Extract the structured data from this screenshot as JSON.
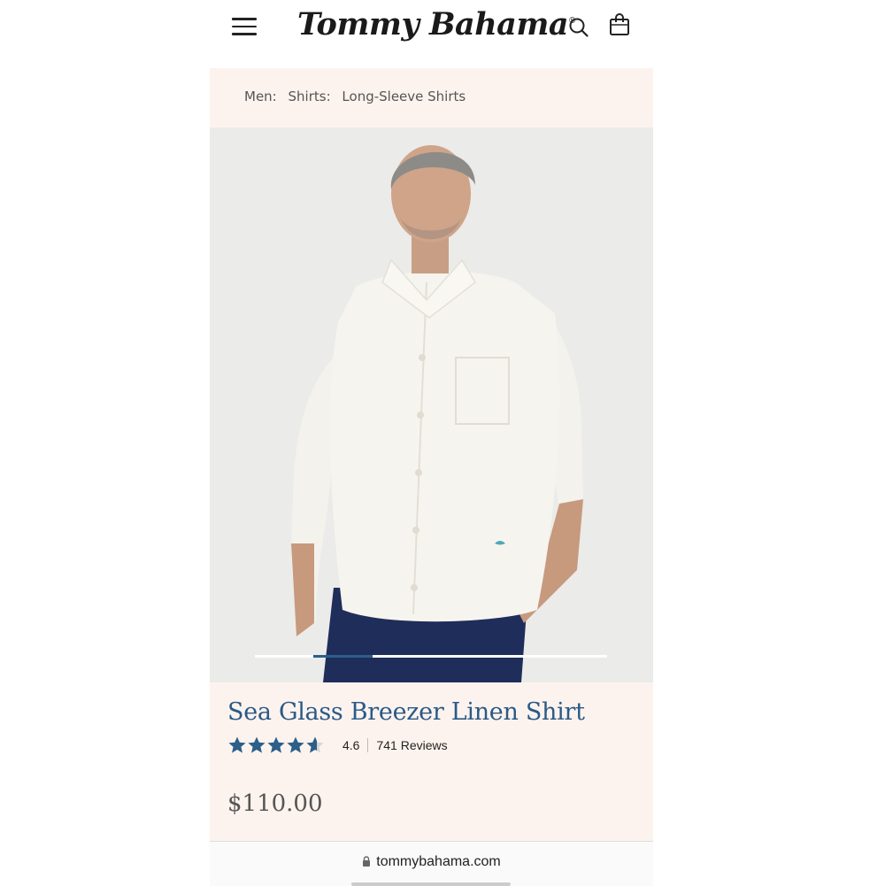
{
  "header": {
    "logo_text": "Tommy Bahama",
    "logo_mark": "®",
    "icons": [
      "menu-icon",
      "search-icon",
      "shopping-bag-icon"
    ]
  },
  "breadcrumb": [
    {
      "label": "Men:"
    },
    {
      "label": "Shirts:"
    },
    {
      "label": "Long-Sleeve Shirts"
    }
  ],
  "product": {
    "title": "Sea Glass Breezer Linen Shirt",
    "rating": "4.6",
    "rating_value": 4.6,
    "rating_max": 5,
    "reviews": "741 Reviews",
    "price": "$110.00",
    "carousel": {
      "active_index": 1,
      "total": 6
    }
  },
  "browser": {
    "url": "tommybahama.com"
  },
  "colors": {
    "accent": "#2a5a87",
    "star": "#2c5f8a",
    "panel": "#fdf3ee",
    "text": "#222222"
  }
}
